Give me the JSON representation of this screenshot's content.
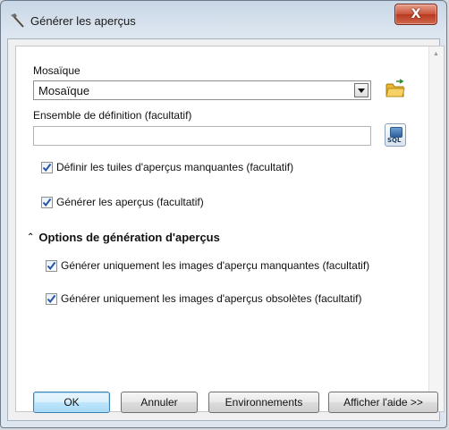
{
  "window": {
    "title": "Générer les aperçus",
    "close_label": "X"
  },
  "form": {
    "mosaic_label": "Mosaïque",
    "mosaic_value": "Mosaïque",
    "definition_label": "Ensemble de définition (facultatif)",
    "definition_value": "",
    "sql_button_label": "SQL",
    "checkboxes": [
      {
        "label": "Définir les tuiles d'aperçus manquantes (facultatif)",
        "checked": true
      },
      {
        "label": "Générer les aperçus (facultatif)",
        "checked": true
      }
    ],
    "section": {
      "title": "Options de génération d'aperçus",
      "checkboxes": [
        {
          "label": "Générer uniquement les images d'aperçu manquantes (facultatif)",
          "checked": true
        },
        {
          "label": "Générer uniquement les images d'aperçus obsolètes (facultatif)",
          "checked": true
        }
      ]
    }
  },
  "buttons": {
    "ok": "OK",
    "cancel": "Annuler",
    "environments": "Environnements",
    "help": "Afficher l'aide >>"
  }
}
